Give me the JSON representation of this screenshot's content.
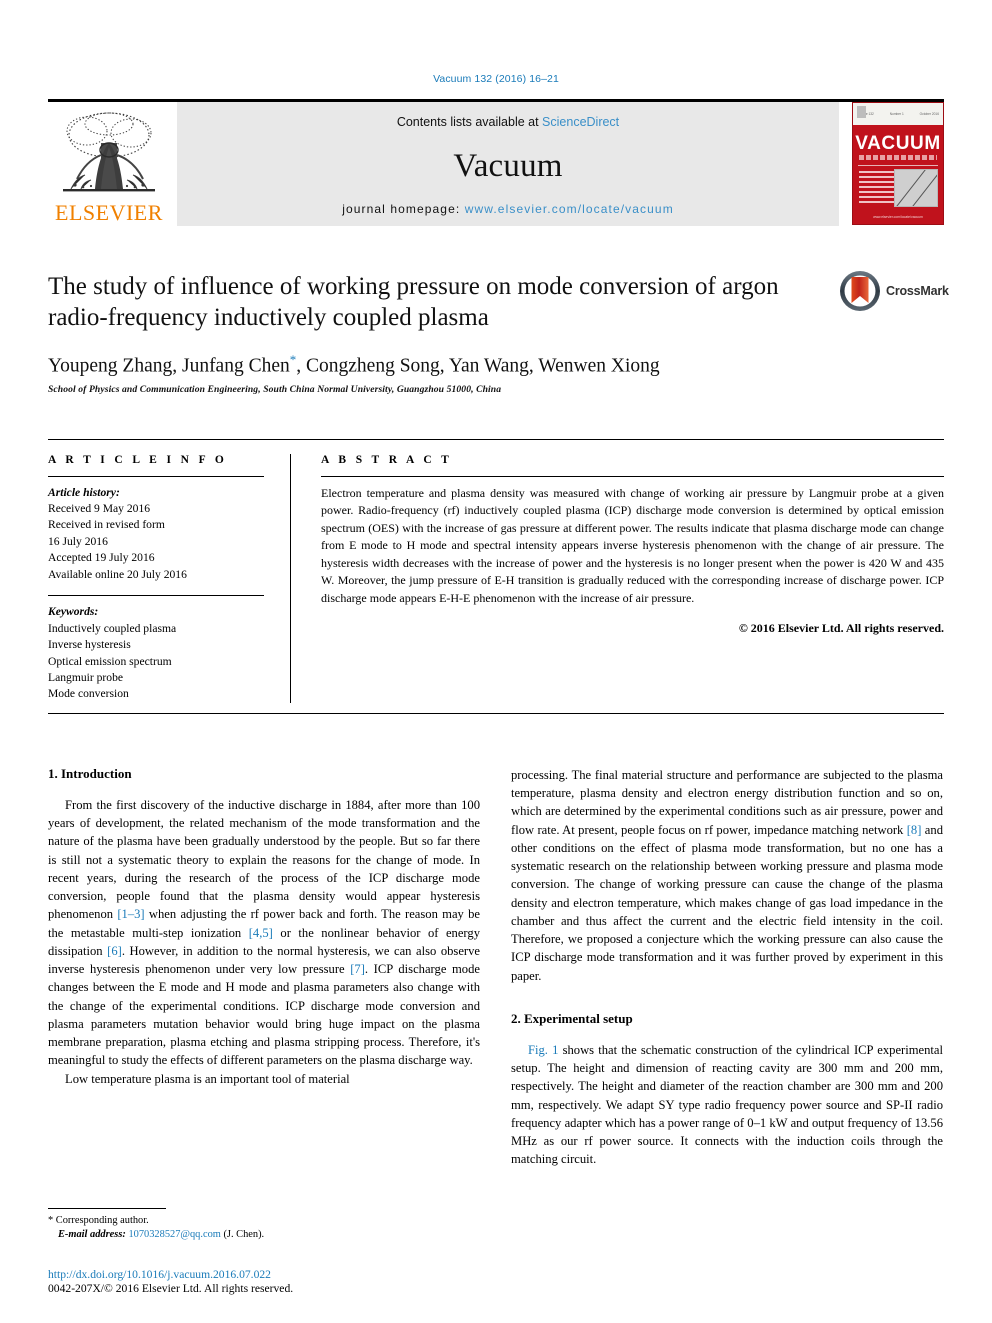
{
  "running_head": "Vacuum 132 (2016) 16–21",
  "masthead": {
    "publisher_logo_name": "elsevier-tree-logo",
    "publisher_word": "ELSEVIER",
    "contents_prefix": "Contents lists available at ",
    "contents_link": "ScienceDirect",
    "journal_name": "Vacuum",
    "homepage_prefix": "journal homepage: ",
    "homepage_url": "www.elsevier.com/locate/vacuum",
    "cover": {
      "title": "VACUUM",
      "top_labels": [
        "Volume 132",
        "Number 1",
        "October 2016"
      ],
      "footer": "www.elsevier.com/locate/vacuum"
    }
  },
  "article": {
    "title": "The study of influence of working pressure on mode conversion of argon radio-frequency inductively coupled plasma",
    "authors": "Youpeng Zhang, Junfang Chen",
    "authors_rest": ", Congzheng Song, Yan Wang, Wenwen Xiong",
    "corresponding_marker": "*",
    "affiliation": "School of Physics and Communication Engineering, South China Normal University, Guangzhou 51000, China",
    "crossmark_label": "CrossMark"
  },
  "article_info": {
    "heading": "A R T I C L E  I N F O",
    "history_label": "Article history:",
    "history": [
      "Received 9 May 2016",
      "Received in revised form",
      "16 July 2016",
      "Accepted 19 July 2016",
      "Available online 20 July 2016"
    ],
    "keywords_label": "Keywords:",
    "keywords": [
      "Inductively coupled plasma",
      "Inverse hysteresis",
      "Optical emission spectrum",
      "Langmuir probe",
      "Mode conversion"
    ]
  },
  "abstract": {
    "heading": "A B S T R A C T",
    "text": "Electron temperature and plasma density was measured with change of working air pressure by Langmuir probe at a given power. Radio-frequency (rf) inductively coupled plasma (ICP) discharge mode conversion is determined by optical emission spectrum (OES) with the increase of gas pressure at different power. The results indicate that plasma discharge mode can change from E mode to H mode and spectral intensity appears inverse hysteresis phenomenon with the change of air pressure. The hysteresis width decreases with the increase of power and the hysteresis is no longer present when the power is 420 W and 435 W. Moreover, the jump pressure of E-H transition is gradually reduced with the corresponding increase of discharge power. ICP discharge mode appears E-H-E phenomenon with the increase of air pressure.",
    "copyright": "© 2016 Elsevier Ltd. All rights reserved."
  },
  "sections": {
    "intro_heading": "1. Introduction",
    "intro_p1_a": "From the first discovery of the inductive discharge in 1884, after more than 100 years of development, the related mechanism of the mode transformation and the nature of the plasma have been gradually understood by the people. But so far there is still not a systematic theory to explain the reasons for the change of mode. In recent years, during the research of the process of the ICP discharge mode conversion, people found that the plasma density would appear hysteresis phenomenon ",
    "ref_1_3": "[1–3]",
    "intro_p1_b": " when adjusting the rf power back and forth. The reason may be the metastable multi-step ionization ",
    "ref_4_5": "[4,5]",
    "intro_p1_c": " or the nonlinear behavior of energy dissipation ",
    "ref_6": "[6]",
    "intro_p1_d": ". However, in addition to the normal hysteresis, we can also observe inverse hysteresis phenomenon under very low pressure ",
    "ref_7": "[7]",
    "intro_p1_e": ". ICP discharge mode changes between the E mode and H mode and plasma parameters also change with the change of the experimental conditions. ICP discharge mode conversion and plasma parameters mutation behavior would bring huge impact on the plasma membrane preparation, plasma etching and plasma stripping process. Therefore, it's meaningful to study the effects of different parameters on the plasma discharge way.",
    "intro_p2": "Low temperature plasma is an important tool of material",
    "right_p1_a": "processing. The final material structure and performance are subjected to the plasma temperature, plasma density and electron energy distribution function and so on, which are determined by the experimental conditions such as air pressure, power and flow rate. At present, people focus on rf power, impedance matching network ",
    "ref_8": "[8]",
    "right_p1_b": " and other conditions on the effect of plasma mode transformation, but no one has a systematic research on the relationship between working pressure and plasma mode conversion. The change of working pressure can cause the change of the plasma density and electron temperature, which makes change of gas load impedance in the chamber and thus affect the current and the electric field intensity in the coil. Therefore, we proposed a conjecture which the working pressure can also cause the ICP discharge mode transformation and it was further proved by experiment in this paper.",
    "setup_heading": "2. Experimental setup",
    "setup_fig_ref": "Fig. 1",
    "setup_p1": " shows that the schematic construction of the cylindrical ICP experimental setup. The height and dimension of reacting cavity are 300 mm and 200 mm, respectively. The height and diameter of the reaction chamber are 300 mm and 200 mm, respectively. We adapt SY type radio frequency power source and SP-II radio frequency adapter which has a power range of 0–1 kW and output frequency of 13.56 MHz as our rf power source. It connects with the induction coils through the matching circuit."
  },
  "footnote": {
    "corresponding": "* Corresponding author.",
    "email_label": "E-mail address:",
    "email": "1070328527@qq.com",
    "email_suffix": " (J. Chen)."
  },
  "page_footer": {
    "doi": "http://dx.doi.org/10.1016/j.vacuum.2016.07.022",
    "issn": "0042-207X/© 2016 Elsevier Ltd. All rights reserved."
  },
  "colors": {
    "link_blue": "#1a7bb9",
    "science_direct_blue": "#3a8fc8",
    "elsevier_orange": "#f08000",
    "cover_red": "#c0121c",
    "band_gray": "#e8e8e8"
  }
}
